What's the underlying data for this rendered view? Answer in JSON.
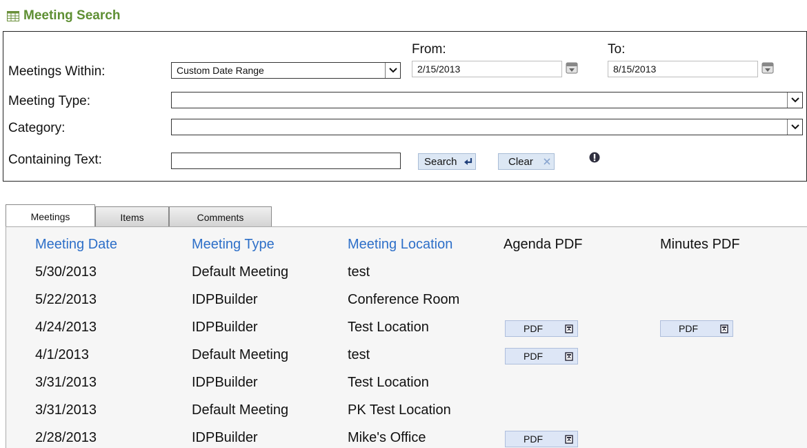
{
  "header": {
    "title": "Meeting Search",
    "icon": "calendar-grid-icon"
  },
  "search": {
    "meetings_within_label": "Meetings Within:",
    "meetings_within_value": "Custom Date Range",
    "from_label": "From:",
    "from_value": "2/15/2013",
    "to_label": "To:",
    "to_value": "8/15/2013",
    "meeting_type_label": "Meeting Type:",
    "meeting_type_value": "",
    "category_label": "Category:",
    "category_value": "",
    "containing_text_label": "Containing Text:",
    "containing_text_value": "",
    "search_button": "Search",
    "clear_button": "Clear"
  },
  "tabs": [
    {
      "label": "Meetings",
      "active": true
    },
    {
      "label": "Items",
      "active": false
    },
    {
      "label": "Comments",
      "active": false
    }
  ],
  "table": {
    "headers": [
      "Meeting Date",
      "Meeting Type",
      "Meeting Location",
      "Agenda PDF",
      "Minutes PDF"
    ],
    "pdf_label": "PDF",
    "rows": [
      {
        "date": "5/30/2013",
        "type": "Default Meeting",
        "location": "test",
        "agenda": false,
        "minutes": false
      },
      {
        "date": "5/22/2013",
        "type": "IDPBuilder",
        "location": "Conference Room",
        "agenda": false,
        "minutes": false
      },
      {
        "date": "4/24/2013",
        "type": "IDPBuilder",
        "location": "Test Location",
        "agenda": true,
        "minutes": true
      },
      {
        "date": "4/1/2013",
        "type": "Default Meeting",
        "location": "test",
        "agenda": true,
        "minutes": false
      },
      {
        "date": "3/31/2013",
        "type": "IDPBuilder",
        "location": "Test Location",
        "agenda": false,
        "minutes": false
      },
      {
        "date": "3/31/2013",
        "type": "Default Meeting",
        "location": "PK Test Location",
        "agenda": false,
        "minutes": false
      },
      {
        "date": "2/28/2013",
        "type": "IDPBuilder",
        "location": "Mike's Office",
        "agenda": true,
        "minutes": false
      }
    ]
  },
  "colors": {
    "title_green": "#5e8f33",
    "link_blue": "#2d6fc8",
    "button_bg": "#dce7f4"
  }
}
